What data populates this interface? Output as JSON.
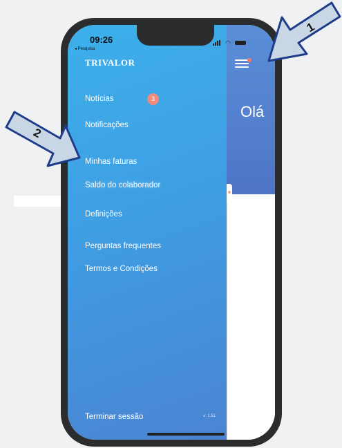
{
  "status_bar": {
    "time": "09:26",
    "back_label": "◂ Pesquisa"
  },
  "brand": "TRIVALOR",
  "menu": {
    "items": [
      {
        "label": "Notícias",
        "badge": "3"
      },
      {
        "label": "Notificações"
      },
      {
        "label": "Minhas faturas"
      },
      {
        "label": "Saldo do colaborador",
        "selected": true
      },
      {
        "label": "Definições"
      },
      {
        "label": "Perguntas frequentes"
      },
      {
        "label": "Termos e Condições"
      }
    ],
    "logout": "Terminar sessão",
    "version": "v: 1.51"
  },
  "main": {
    "greeting": "Olá"
  },
  "callouts": [
    {
      "number": "1",
      "target": "menu-button"
    },
    {
      "number": "2",
      "target": "Minhas faturas"
    }
  ],
  "colors": {
    "drawer_top": "#3cb0ea",
    "drawer_bottom": "#4a84d2",
    "badge": "#f08a7c",
    "callout_fill": "#c9d6e6",
    "callout_stroke": "#1f3c8a"
  },
  "icons": {
    "menu": "hamburger-icon",
    "callout": "arrow-icon"
  }
}
